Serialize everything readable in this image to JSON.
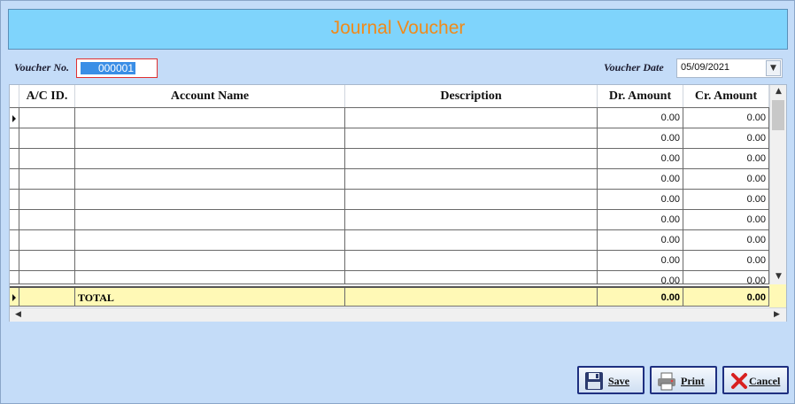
{
  "header": {
    "title": "Journal Voucher"
  },
  "voucher": {
    "no_label": "Voucher No.",
    "no_value": "000001",
    "date_label": "Voucher Date",
    "date_value": "05/09/2021"
  },
  "grid": {
    "columns": [
      "A/C ID.",
      "Account Name",
      "Description",
      "Dr. Amount",
      "Cr. Amount"
    ],
    "rows": [
      {
        "ac_id": "",
        "account_name": "",
        "description": "",
        "dr": "0.00",
        "cr": "0.00"
      },
      {
        "ac_id": "",
        "account_name": "",
        "description": "",
        "dr": "0.00",
        "cr": "0.00"
      },
      {
        "ac_id": "",
        "account_name": "",
        "description": "",
        "dr": "0.00",
        "cr": "0.00"
      },
      {
        "ac_id": "",
        "account_name": "",
        "description": "",
        "dr": "0.00",
        "cr": "0.00"
      },
      {
        "ac_id": "",
        "account_name": "",
        "description": "",
        "dr": "0.00",
        "cr": "0.00"
      },
      {
        "ac_id": "",
        "account_name": "",
        "description": "",
        "dr": "0.00",
        "cr": "0.00"
      },
      {
        "ac_id": "",
        "account_name": "",
        "description": "",
        "dr": "0.00",
        "cr": "0.00"
      },
      {
        "ac_id": "",
        "account_name": "",
        "description": "",
        "dr": "0.00",
        "cr": "0.00"
      },
      {
        "ac_id": "",
        "account_name": "",
        "description": "",
        "dr": "0.00",
        "cr": "0.00"
      }
    ],
    "total": {
      "label": "TOTAL",
      "dr": "0.00",
      "cr": "0.00"
    }
  },
  "buttons": {
    "save": "Save",
    "print": "Print",
    "cancel": "Cancel"
  },
  "icons": {
    "save": "floppy-disk-icon",
    "print": "printer-icon",
    "cancel": "red-x-icon",
    "date_dropdown": "chevron-down-icon"
  },
  "colors": {
    "background": "#c4dcf8",
    "header_bg": "#7fd4fc",
    "title": "#f08a1a",
    "total_row": "#fff9b6",
    "selection": "#3a8ee6"
  }
}
